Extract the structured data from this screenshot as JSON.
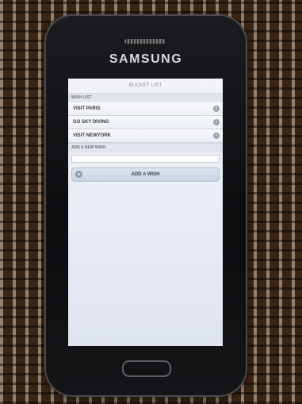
{
  "device": {
    "brand": "SAMSUNG"
  },
  "app": {
    "title": "BUCKET LIST",
    "wish_list_header": "WISH LIST",
    "wishes": [
      {
        "label": "VISIT PARIS"
      },
      {
        "label": "GO SKY DIVING"
      },
      {
        "label": "VISIT NEWYORK"
      }
    ],
    "add_section_header": "ADD A NEW WISH",
    "new_wish_value": "",
    "add_button_label": "ADD A WISH"
  },
  "icons": {
    "item_chevron": "chevron-right-icon",
    "add_button": "plus-icon"
  },
  "colors": {
    "screen_bg": "#eef0f5",
    "button_bg": "#cfd7e6",
    "phone_body": "#141417"
  }
}
